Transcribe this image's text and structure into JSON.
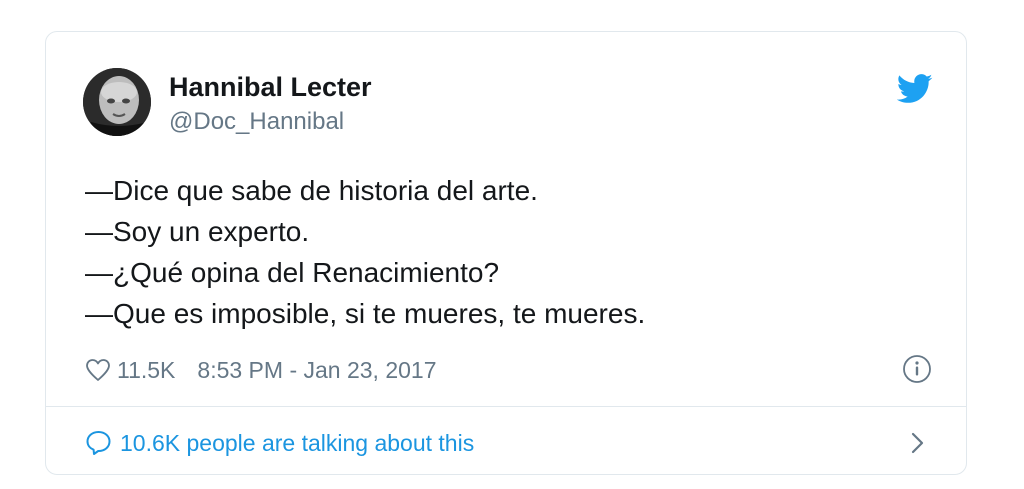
{
  "tweet": {
    "author_name": "Hannibal Lecter",
    "author_handle": "@Doc_Hannibal",
    "lines": [
      "—Dice que sabe de historia del arte.",
      "—Soy un experto.",
      "—¿Qué opina del Renacimiento?",
      "—Que es imposible, si te mueres, te mueres."
    ],
    "likes": "11.5K",
    "timestamp": "8:53 PM - Jan 23, 2017",
    "talking": "10.6K people are talking about this"
  },
  "icons": {
    "brand": "twitter-bird-icon",
    "like": "heart-icon",
    "info": "info-icon",
    "reply": "speech-bubble-icon",
    "more": "chevron-right-icon"
  },
  "colors": {
    "brand": "#1da1f2",
    "link": "#1b95e0",
    "muted": "#657786",
    "border": "#e1e8ed",
    "text": "#14171a"
  }
}
